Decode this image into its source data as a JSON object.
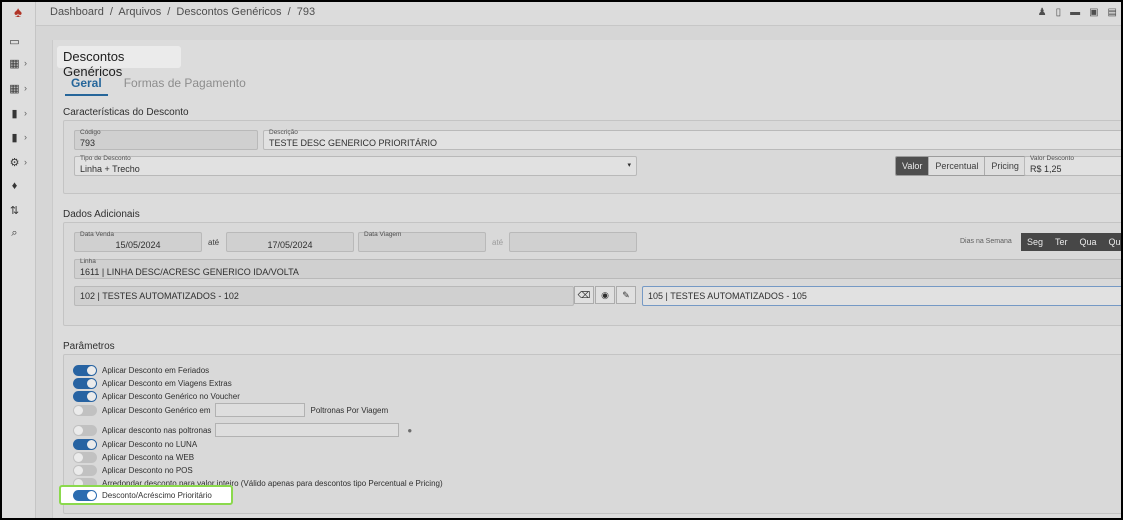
{
  "breadcrumb": [
    "Dashboard",
    "/",
    "Arquivos",
    "/",
    "Descontos Genéricos",
    "/",
    "793"
  ],
  "page_title": "Descontos Genéricos",
  "tabs": [
    {
      "label": "Geral",
      "active": true
    },
    {
      "label": "Formas de Pagamento",
      "active": false
    }
  ],
  "caracteristicas": {
    "title": "Características do Desconto",
    "codigo_label": "Código",
    "codigo_value": "793",
    "descricao_label": "Descrição",
    "descricao_value": "TESTE DESC GENERICO PRIORITÁRIO",
    "tipo_label": "Tipo de Desconto",
    "tipo_value": "Linha + Trecho",
    "valor_buttons": [
      "Valor",
      "Percentual",
      "Pricing"
    ],
    "valor_active": "Valor",
    "valor_label": "Valor Desconto",
    "valor_value": "R$ 1,25"
  },
  "adicionais": {
    "title": "Dados Adicionais",
    "data_venda_label": "Data Venda",
    "data_venda_from": "15/05/2024",
    "ate": "até",
    "data_venda_to": "17/05/2024",
    "data_viagem_label": "Data Viagem",
    "ate2": "até",
    "dias_label": "Dias na Semana",
    "dias": [
      "Seg",
      "Ter",
      "Qua",
      "Qui"
    ],
    "linha_label": "Linha",
    "linha_value": "1611 | LINHA DESC/ACRESC GENERICO IDA/VOLTA",
    "trecho_origem": "102 | TESTES AUTOMATIZADOS - 102",
    "trecho_destino": "105 | TESTES AUTOMATIZADOS - 105"
  },
  "parametros": {
    "title": "Parâmetros",
    "items": [
      {
        "label": "Aplicar Desconto em Feriados",
        "on": true
      },
      {
        "label": "Aplicar Desconto em Viagens Extras",
        "on": true
      },
      {
        "label": "Aplicar Desconto Genérico no Voucher",
        "on": true
      },
      {
        "label": "Aplicar Desconto Genérico em",
        "on": false,
        "suffix": "Poltronas Por Viagem"
      },
      {
        "label": "Aplicar desconto nas poltronas",
        "on": false
      },
      {
        "label": "Aplicar Desconto no LUNA",
        "on": true
      },
      {
        "label": "Aplicar Desconto na WEB",
        "on": false
      },
      {
        "label": "Aplicar Desconto no POS",
        "on": false
      },
      {
        "label": "Arredondar desconto para valor inteiro (Válido apenas para descontos tipo Percentual e Pricing)",
        "on": false
      }
    ],
    "highlighted": {
      "label": "Desconto/Acréscimo Prioritário",
      "on": true
    }
  }
}
